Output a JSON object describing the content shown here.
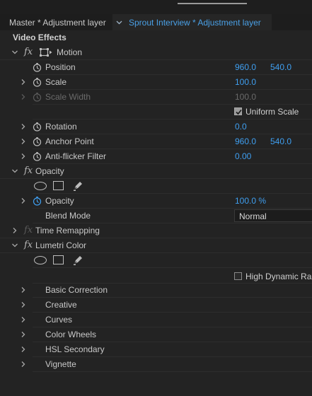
{
  "tabs": {
    "master_label": "Master * Adjustment layer",
    "clip_label": "Sprout Interview * Adjustment layer"
  },
  "section": {
    "title": "Video Effects"
  },
  "motion": {
    "fx": "fx",
    "label": "Motion",
    "position": {
      "label": "Position",
      "x": "960.0",
      "y": "540.0"
    },
    "scale": {
      "label": "Scale",
      "value": "100.0"
    },
    "scale_width": {
      "label": "Scale Width",
      "value": "100.0"
    },
    "uniform_scale": {
      "label": "Uniform Scale",
      "checked": true
    },
    "rotation": {
      "label": "Rotation",
      "value": "0.0"
    },
    "anchor_point": {
      "label": "Anchor Point",
      "x": "960.0",
      "y": "540.0"
    },
    "anti_flicker": {
      "label": "Anti-flicker Filter",
      "value": "0.00"
    }
  },
  "opacity": {
    "fx": "fx",
    "label": "Opacity",
    "opacity_prop": {
      "label": "Opacity",
      "value": "100.0 %"
    },
    "blend_mode": {
      "label": "Blend Mode",
      "value": "Normal"
    }
  },
  "time_remapping": {
    "fx": "fx",
    "label": "Time Remapping"
  },
  "lumetri": {
    "fx": "fx",
    "label": "Lumetri Color",
    "hdr": {
      "label": "High Dynamic Ran",
      "checked": false
    },
    "groups": [
      "Basic Correction",
      "Creative",
      "Curves",
      "Color Wheels",
      "HSL Secondary",
      "Vignette"
    ]
  },
  "colors": {
    "accent_blue": "#3f9ff0",
    "panel_bg": "#232323",
    "tab_bg": "#1d1d1d"
  }
}
